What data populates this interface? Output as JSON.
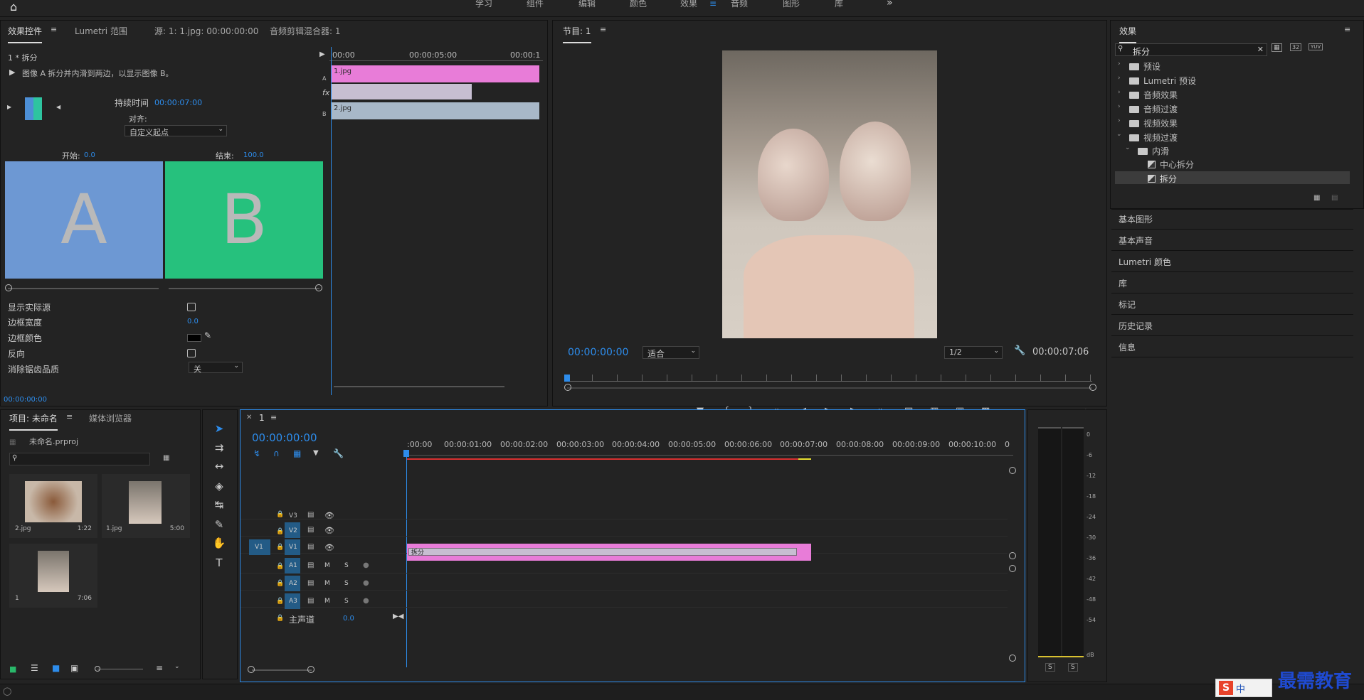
{
  "workspace": {
    "tabs": [
      "学习",
      "组件",
      "编辑",
      "颜色",
      "效果",
      "音频",
      "图形",
      "库"
    ],
    "active": "效果",
    "more": "»"
  },
  "effect_controls": {
    "tabs": [
      "效果控件",
      "Lumetri 范围",
      "源: 1: 1.jpg: 00:00:00:00",
      "音频剪辑混合器: 1"
    ],
    "clip": "1 * 拆分",
    "desc": "图像 A 拆分并内滑到两边，以显示图像 B。",
    "duration_label": "持续时间",
    "duration_value": "00:00:07:00",
    "align_label": "对齐:",
    "align_value": "自定义起点",
    "start_label": "开始:",
    "start_value": "0.0",
    "end_label": "结束:",
    "end_value": "100.0",
    "a_letter": "A",
    "b_letter": "B",
    "props": [
      {
        "label": "显示实际源"
      },
      {
        "label": "边框宽度",
        "value": "0.0"
      },
      {
        "label": "边框颜色"
      },
      {
        "label": "反向"
      },
      {
        "label": "消除锯齿品质",
        "value": "关"
      }
    ],
    "timecode": "00:00:00:00",
    "mini_ruler": [
      "00:00",
      "00:00:05:00",
      "00:00:1"
    ],
    "clip_a": "1.jpg",
    "clip_b": "2.jpg",
    "track_a": "A",
    "track_b": "B",
    "fx_label": "fx"
  },
  "program": {
    "title": "节目: 1",
    "timecode": "00:00:00:00",
    "fit": "适合",
    "quality": "1/2",
    "duration": "00:00:07:06"
  },
  "effects_panel": {
    "title": "效果",
    "search": "拆分",
    "icons": [
      "32",
      "32",
      "YUV"
    ],
    "tree": [
      {
        "label": "预设",
        "level": 0
      },
      {
        "label": "Lumetri 预设",
        "level": 0
      },
      {
        "label": "音频效果",
        "level": 0
      },
      {
        "label": "音频过渡",
        "level": 0
      },
      {
        "label": "视频效果",
        "level": 0
      },
      {
        "label": "视频过渡",
        "level": 0,
        "open": true
      },
      {
        "label": "内滑",
        "level": 1,
        "open": true
      },
      {
        "label": "中心拆分",
        "level": 2
      },
      {
        "label": "拆分",
        "level": 2,
        "selected": true
      }
    ],
    "sections": [
      "基本图形",
      "基本声音",
      "Lumetri 颜色",
      "库",
      "标记",
      "历史记录",
      "信息"
    ]
  },
  "project": {
    "tabs": [
      "项目: 未命名",
      "媒体浏览器"
    ],
    "file": "未命名.prproj",
    "items": [
      {
        "name": "2.jpg",
        "dur": "1:22"
      },
      {
        "name": "1.jpg",
        "dur": "5:00"
      },
      {
        "name": "1",
        "dur": "7:06"
      }
    ]
  },
  "timeline": {
    "seq": "1",
    "timecode": "00:00:00:00",
    "ruler": [
      ":00:00",
      "00:00:01:00",
      "00:00:02:00",
      "00:00:03:00",
      "00:00:04:00",
      "00:00:05:00",
      "00:00:06:00",
      "00:00:07:00",
      "00:00:08:00",
      "00:00:09:00",
      "00:00:10:00",
      "0"
    ],
    "video_tracks": [
      "V3",
      "V2",
      "V1"
    ],
    "audio_tracks": [
      "A1",
      "A2",
      "A3"
    ],
    "src_v": "V1",
    "m": "M",
    "s": "S",
    "master_label": "主声道",
    "master_value": "0.0",
    "transition": "拆分"
  },
  "meter": {
    "scale": [
      "0",
      "-6",
      "-12",
      "-18",
      "-24",
      "-30",
      "-36",
      "-42",
      "-48",
      "-54",
      "dB"
    ],
    "solo": [
      "S",
      "S"
    ]
  },
  "watermark": {
    "text": "最需教育",
    "ime": "中"
  }
}
